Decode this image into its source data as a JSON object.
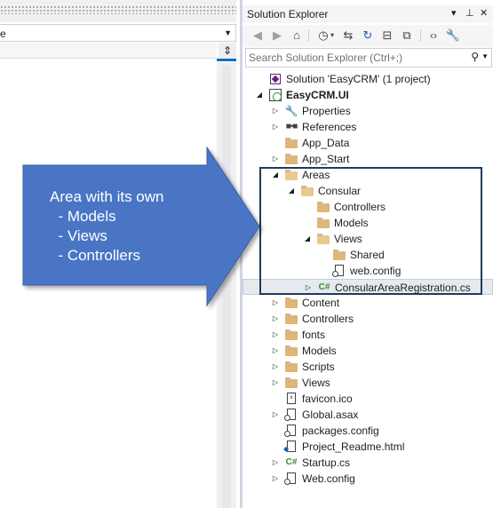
{
  "editor": {
    "combo_text": "e",
    "combo_arrow_icon": "chevron-down-icon",
    "split_icon": "split-editor-icon"
  },
  "solution_explorer": {
    "title": "Solution Explorer",
    "title_buttons": [
      "dropdown-icon",
      "pin-icon",
      "close-icon"
    ],
    "toolbar": [
      "back-icon",
      "forward-icon",
      "home-icon",
      "history-icon",
      "sync-icon",
      "refresh-icon",
      "collapse-all-icon",
      "show-all-files-icon",
      "view-code-icon",
      "properties-icon"
    ],
    "search": {
      "placeholder": "Search Solution Explorer (Ctrl+;)"
    },
    "tree": [
      {
        "label": "Solution 'EasyCRM' (1 project)",
        "icon": "solution-icon",
        "expander": "none"
      },
      {
        "label": "EasyCRM.UI",
        "icon": "web-project-icon",
        "expander": "expanded",
        "bold": true
      },
      {
        "label": "Properties",
        "icon": "wrench-icon",
        "expander": "collapsed"
      },
      {
        "label": "References",
        "icon": "references-icon",
        "expander": "collapsed"
      },
      {
        "label": "App_Data",
        "icon": "folder-icon",
        "expander": "none"
      },
      {
        "label": "App_Start",
        "icon": "folder-icon",
        "expander": "collapsed"
      },
      {
        "label": "Areas",
        "icon": "folder-open-icon",
        "expander": "expanded"
      },
      {
        "label": "Consular",
        "icon": "folder-open-icon",
        "expander": "expanded"
      },
      {
        "label": "Controllers",
        "icon": "folder-icon",
        "expander": "none"
      },
      {
        "label": "Models",
        "icon": "folder-icon",
        "expander": "none"
      },
      {
        "label": "Views",
        "icon": "folder-open-icon",
        "expander": "expanded"
      },
      {
        "label": "Shared",
        "icon": "folder-icon",
        "expander": "none"
      },
      {
        "label": "web.config",
        "icon": "config-file-icon",
        "expander": "none"
      },
      {
        "label": "ConsularAreaRegistration.cs",
        "icon": "csharp-file-icon",
        "expander": "collapsed",
        "selected": true
      },
      {
        "label": "Content",
        "icon": "folder-icon",
        "expander": "collapsed"
      },
      {
        "label": "Controllers",
        "icon": "folder-icon",
        "expander": "collapsed"
      },
      {
        "label": "fonts",
        "icon": "folder-icon",
        "expander": "collapsed"
      },
      {
        "label": "Models",
        "icon": "folder-icon",
        "expander": "collapsed"
      },
      {
        "label": "Scripts",
        "icon": "folder-icon",
        "expander": "collapsed"
      },
      {
        "label": "Views",
        "icon": "folder-icon",
        "expander": "collapsed"
      },
      {
        "label": "favicon.ico",
        "icon": "icon-file-icon",
        "expander": "none"
      },
      {
        "label": "Global.asax",
        "icon": "asax-file-icon",
        "expander": "collapsed"
      },
      {
        "label": "packages.config",
        "icon": "config-file-icon",
        "expander": "none"
      },
      {
        "label": "Project_Readme.html",
        "icon": "html-file-icon",
        "expander": "none"
      },
      {
        "label": "Startup.cs",
        "icon": "csharp-file-icon",
        "expander": "collapsed"
      },
      {
        "label": "Web.config",
        "icon": "config-file-icon",
        "expander": "collapsed"
      }
    ]
  },
  "callout": {
    "line1": "Area with its own",
    "line2": "  - Models",
    "line3": "  - Views",
    "line4": "  - Controllers",
    "fill_color": "#4a74c4",
    "box_color": "#1f3b5e"
  }
}
